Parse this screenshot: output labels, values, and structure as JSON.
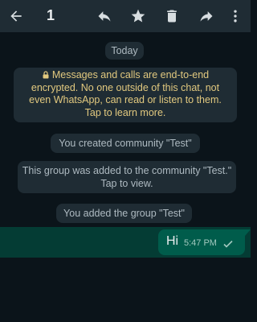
{
  "toolbar": {
    "selected_count": "1",
    "icons": [
      "back-arrow-icon",
      "reply-icon",
      "star-icon",
      "delete-icon",
      "forward-icon",
      "more-vert-icon"
    ]
  },
  "chat": {
    "date_label": "Today",
    "encryption_notice": "Messages and calls are end-to-end encrypted. No one outside of this chat, not even WhatsApp, can read or listen to them. Tap to learn more.",
    "system_messages": [
      "You created community \"Test\"",
      "This group was added to the community \"Test.\" Tap to view.",
      "You added the group \"Test\""
    ],
    "message": {
      "text": "Hi",
      "time": "5:47 PM",
      "status": "sent"
    }
  },
  "colors": {
    "background": "#0b141a",
    "bar": "#1f2c34",
    "outgoing_bubble": "#005c4b",
    "encryption_text": "#e2c97f"
  }
}
